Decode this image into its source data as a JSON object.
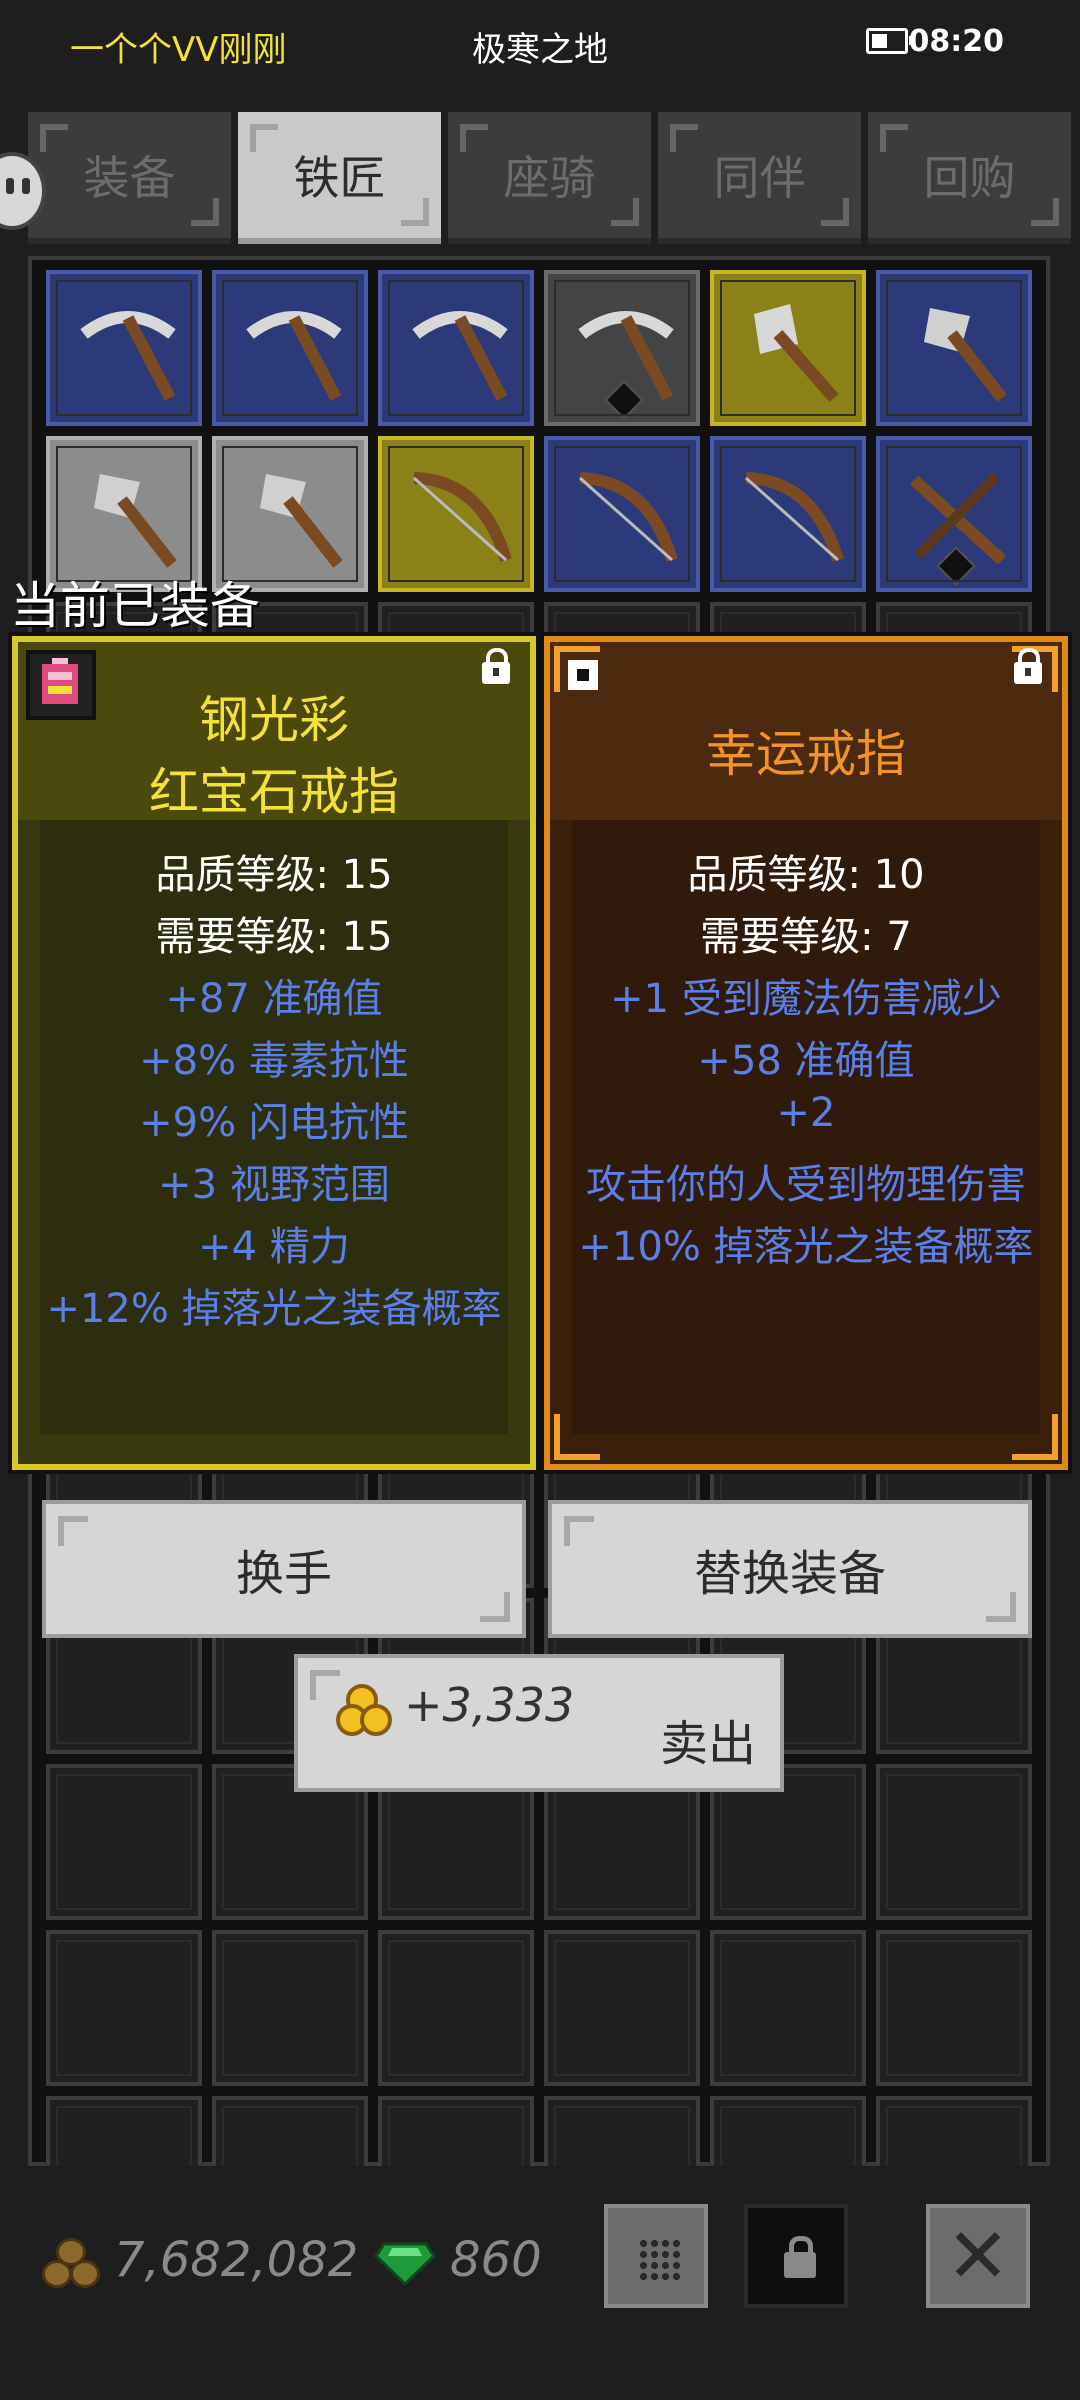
{
  "status_bar": {
    "left_text": "一个个VV刚刚",
    "center_text": "极寒之地",
    "time": "08:20"
  },
  "tabs": [
    {
      "label": "装备",
      "active": false
    },
    {
      "label": "铁匠",
      "active": true
    },
    {
      "label": "座骑",
      "active": false
    },
    {
      "label": "同伴",
      "active": false
    },
    {
      "label": "回购",
      "active": false
    }
  ],
  "inventory": {
    "row1": [
      {
        "rarity": "blue",
        "icon": "pickaxe-icon"
      },
      {
        "rarity": "blue",
        "icon": "pickaxe-icon"
      },
      {
        "rarity": "blue",
        "icon": "pickaxe-icon"
      },
      {
        "rarity": "darkgray",
        "icon": "pickaxe-icon",
        "socket": true
      },
      {
        "rarity": "yellow",
        "icon": "double-axe-icon"
      },
      {
        "rarity": "blue",
        "icon": "axe-icon"
      }
    ],
    "row2": [
      {
        "rarity": "gray",
        "icon": "axe-icon"
      },
      {
        "rarity": "gray",
        "icon": "axe-icon"
      },
      {
        "rarity": "yellow",
        "icon": "bow-icon"
      },
      {
        "rarity": "blue",
        "icon": "bow-icon"
      },
      {
        "rarity": "blue",
        "icon": "bow-icon"
      },
      {
        "rarity": "blue",
        "icon": "crossbow-icon",
        "socket": true
      }
    ]
  },
  "equipped_label": "当前已装备",
  "card_left": {
    "title_line1": "钢光彩",
    "title_line2": "红宝石戒指",
    "quality_level": "品质等级: 15",
    "required_level": "需要等级: 15",
    "stats": [
      "+87 准确值",
      "+8% 毒素抗性",
      "+9% 闪电抗性",
      "+3 视野范围",
      "+4 精力",
      "+12% 掉落光之装备概率"
    ],
    "title_color": "#f2e23a"
  },
  "card_right": {
    "title": "幸运戒指",
    "quality_level": "品质等级: 10",
    "required_level": "需要等级: 7",
    "stats": [
      "+1 受到魔法伤害减少",
      "+58 准确值",
      "+2",
      "攻击你的人受到物理伤害",
      "+10% 掉落光之装备概率"
    ],
    "title_color": "#f2922a"
  },
  "buttons": {
    "swap_hand": "换手",
    "replace": "替换装备",
    "sell_price": "+3,333",
    "sell_label": "卖出"
  },
  "bottom_bar": {
    "gold": "7,682,082",
    "gems": "860"
  },
  "colors": {
    "stat_blue": "#5b7fe6",
    "card_left_border": "#d8c92a",
    "card_right_border": "#e08a1a"
  }
}
